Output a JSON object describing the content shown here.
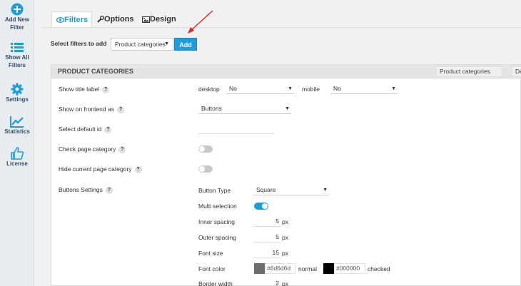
{
  "sidebar": {
    "items": [
      {
        "icon": "plus-circle-icon",
        "label_line1": "Add New",
        "label_line2": "Filter"
      },
      {
        "icon": "list-icon",
        "label_line1": "Show All",
        "label_line2": "Filters"
      },
      {
        "icon": "gear-icon",
        "label_line1": "Settings",
        "label_line2": ""
      },
      {
        "icon": "chart-line-icon",
        "label_line1": "Statistics",
        "label_line2": ""
      },
      {
        "icon": "thumbs-up-icon",
        "label_line1": "License",
        "label_line2": ""
      }
    ]
  },
  "tabs": [
    {
      "label": "Filters",
      "icon": "eye-icon",
      "active": true
    },
    {
      "label": "Options",
      "icon": "wrench-icon",
      "active": false
    },
    {
      "label": "Design",
      "icon": "image-icon",
      "active": false
    }
  ],
  "add_filter": {
    "label": "Select filters to add",
    "selected": "Product categories",
    "button": "Add"
  },
  "panel": {
    "title": "PRODUCT CATEGORIES",
    "name_value": "Product categories",
    "extra_value": "De"
  },
  "settings": {
    "show_title_label": {
      "label": "Show title label",
      "desktop_label": "desktop",
      "desktop_value": "No",
      "mobile_label": "mobile",
      "mobile_value": "No"
    },
    "show_on_frontend": {
      "label": "Show on frontend as",
      "value": "Buttons"
    },
    "default_id": {
      "label": "Select default id",
      "value": ""
    },
    "check_page_category": {
      "label": "Check page category",
      "enabled": false
    },
    "hide_current_category": {
      "label": "Hide current page category",
      "enabled": false
    },
    "buttons_settings": {
      "label": "Buttons Settings"
    }
  },
  "buttons": {
    "button_type_label": "Button Type",
    "button_type_value": "Square",
    "multi_selection_label": "Multi selection",
    "multi_selection": true,
    "inner_spacing_label": "Inner spacing",
    "inner_spacing": "5",
    "outer_spacing_label": "Outer spacing",
    "outer_spacing": "5",
    "font_size_label": "Font size",
    "font_size": "15",
    "font_color_label": "Font color",
    "font_color_normal": "#6d6d6d",
    "normal_label": "normal",
    "font_color_checked": "#000000",
    "checked_label": "checked",
    "border_width_label": "Border width",
    "border_width": "2",
    "unit": "px"
  },
  "colors": {
    "accent": "#1f9cdb",
    "normal_swatch": "#6d6d6d",
    "checked_swatch": "#000000",
    "arrow": "#e0251b"
  }
}
